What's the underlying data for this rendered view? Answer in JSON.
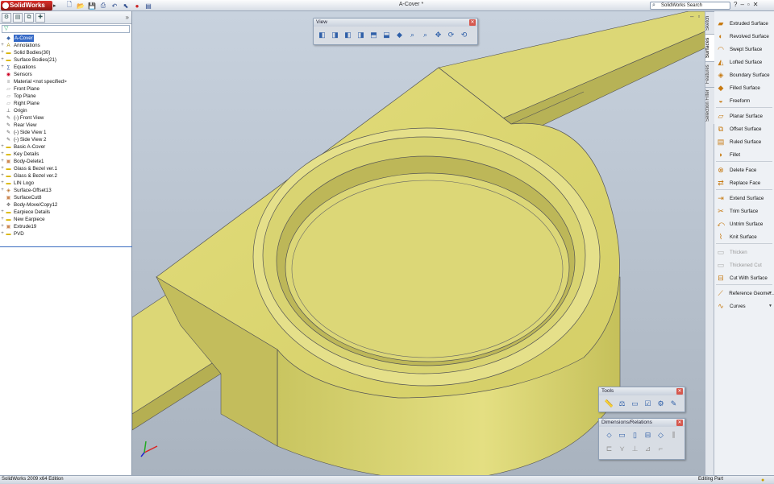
{
  "app": {
    "logo": "SolidWorks",
    "window_title": "A-Cover *",
    "search_placeholder": "SolidWorks Search",
    "status_left": "SolidWorks 2009 x64 Edition",
    "status_right": "Editing Part"
  },
  "feature_tree": {
    "filter_symbol": "▽",
    "items": [
      {
        "label": "A-Cover",
        "icon": "part-icon",
        "expandable": false,
        "selected": true
      },
      {
        "label": "Annotations",
        "icon": "annotations-icon",
        "expandable": true
      },
      {
        "label": "Solid Bodies(30)",
        "icon": "folder-icon",
        "expandable": true
      },
      {
        "label": "Surface Bodies(21)",
        "icon": "folder-icon",
        "expandable": true
      },
      {
        "label": "Equations",
        "icon": "equations-icon",
        "expandable": true
      },
      {
        "label": "Sensors",
        "icon": "sensor-icon",
        "expandable": false
      },
      {
        "label": "Material <not specified>",
        "icon": "material-icon",
        "expandable": false
      },
      {
        "label": "Front Plane",
        "icon": "plane-icon",
        "expandable": false
      },
      {
        "label": "Top Plane",
        "icon": "plane-icon",
        "expandable": false
      },
      {
        "label": "Right Plane",
        "icon": "plane-icon",
        "expandable": false
      },
      {
        "label": "Origin",
        "icon": "origin-icon",
        "expandable": false
      },
      {
        "label": "(-) Front View",
        "icon": "sketch-icon",
        "expandable": false
      },
      {
        "label": "Rear View",
        "icon": "sketch-icon",
        "expandable": false
      },
      {
        "label": "(-) Side View 1",
        "icon": "sketch-icon",
        "expandable": false
      },
      {
        "label": "(-) Side View 2",
        "icon": "sketch-icon",
        "expandable": false
      },
      {
        "label": "Basic A-Cover",
        "icon": "folder-icon",
        "expandable": true
      },
      {
        "label": "Key Details",
        "icon": "folder-icon",
        "expandable": true
      },
      {
        "label": "Body-Delete1",
        "icon": "feature-icon",
        "expandable": true
      },
      {
        "label": "Glass & Bezel ver.1",
        "icon": "folder-icon",
        "expandable": true
      },
      {
        "label": "Glass & Bezel ver.2",
        "icon": "folder-icon",
        "expandable": true
      },
      {
        "label": "LIN Logo",
        "icon": "folder-icon",
        "expandable": true
      },
      {
        "label": "Surface-Offset13",
        "icon": "surface-icon",
        "expandable": true
      },
      {
        "label": "SurfaceCut8",
        "icon": "feature-icon",
        "expandable": false
      },
      {
        "label": "Body-Move/Copy12",
        "icon": "move-icon",
        "expandable": false
      },
      {
        "label": "Earpiece Details",
        "icon": "folder-icon",
        "expandable": true
      },
      {
        "label": "New Earpiece",
        "icon": "folder-icon",
        "expandable": true
      },
      {
        "label": "Extrude19",
        "icon": "feature-icon",
        "expandable": true
      },
      {
        "label": "PVD",
        "icon": "folder-icon",
        "expandable": true
      }
    ]
  },
  "view_toolbar": {
    "title": "View"
  },
  "tools_toolbar": {
    "title": "Tools"
  },
  "dimensions_toolbar": {
    "title": "Dimensions/Relations"
  },
  "command_tabs": [
    "Sketch",
    "Surfaces",
    "Features",
    "Selection Filter"
  ],
  "surfaces_commands": [
    {
      "label": "Extruded Surface",
      "icon": "extruded-surface-icon",
      "enabled": true
    },
    {
      "label": "Revolved Surface",
      "icon": "revolved-surface-icon",
      "enabled": true
    },
    {
      "label": "Swept Surface",
      "icon": "swept-surface-icon",
      "enabled": true
    },
    {
      "label": "Lofted Surface",
      "icon": "lofted-surface-icon",
      "enabled": true
    },
    {
      "label": "Boundary Surface",
      "icon": "boundary-surface-icon",
      "enabled": true
    },
    {
      "label": "Filled Surface",
      "icon": "filled-surface-icon",
      "enabled": true
    },
    {
      "label": "Freeform",
      "icon": "freeform-icon",
      "enabled": true
    },
    {
      "label": "Planar Surface",
      "icon": "planar-surface-icon",
      "enabled": true
    },
    {
      "label": "Offset Surface",
      "icon": "offset-surface-icon",
      "enabled": true
    },
    {
      "label": "Ruled Surface",
      "icon": "ruled-surface-icon",
      "enabled": true
    },
    {
      "label": "Fillet",
      "icon": "fillet-icon",
      "enabled": true
    },
    {
      "label": "Delete Face",
      "icon": "delete-face-icon",
      "enabled": true
    },
    {
      "label": "Replace Face",
      "icon": "replace-face-icon",
      "enabled": true
    },
    {
      "label": "Extend Surface",
      "icon": "extend-surface-icon",
      "enabled": true
    },
    {
      "label": "Trim Surface",
      "icon": "trim-surface-icon",
      "enabled": true
    },
    {
      "label": "Untrim Surface",
      "icon": "untrim-surface-icon",
      "enabled": true
    },
    {
      "label": "Knit Surface",
      "icon": "knit-surface-icon",
      "enabled": true
    },
    {
      "label": "Thicken",
      "icon": "thicken-icon",
      "enabled": false
    },
    {
      "label": "Thickened Cut",
      "icon": "thickened-cut-icon",
      "enabled": false
    },
    {
      "label": "Cut With Surface",
      "icon": "cut-with-surface-icon",
      "enabled": true
    },
    {
      "label": "Reference Geome...",
      "icon": "reference-geometry-icon",
      "enabled": true
    },
    {
      "label": "Curves",
      "icon": "curves-icon",
      "enabled": true
    }
  ],
  "colors": {
    "part_yellow": "#d6d26a",
    "selection_blue": "#3469c7",
    "logo_red": "#c8251e"
  }
}
